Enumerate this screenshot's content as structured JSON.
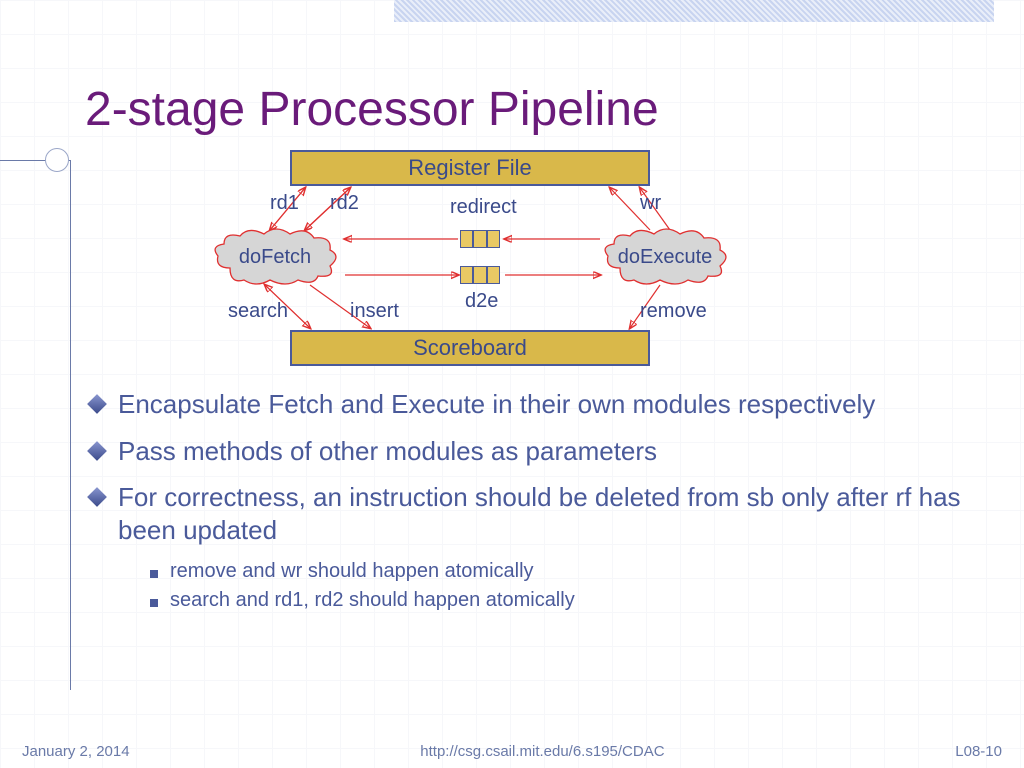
{
  "title": "2-stage Processor Pipeline",
  "diagram": {
    "register_file": "Register File",
    "scoreboard": "Scoreboard",
    "doFetch": "doFetch",
    "doExecute": "doExecute",
    "labels": {
      "rd1": "rd1",
      "rd2": "rd2",
      "redirect": "redirect",
      "wr": "wr",
      "search": "search",
      "insert": "insert",
      "d2e": "d2e",
      "remove": "remove"
    }
  },
  "bullets": [
    "Encapsulate Fetch and Execute in their own modules respectively",
    "Pass methods of other modules as parameters",
    "For correctness, an instruction should be deleted from sb only after rf has been updated"
  ],
  "subbullets": [
    "remove and wr should happen atomically",
    "search and rd1, rd2 should happen atomically"
  ],
  "footer": {
    "date": "January 2, 2014",
    "url": "http://csg.csail.mit.edu/6.s195/CDAC",
    "page": "L08-10"
  }
}
